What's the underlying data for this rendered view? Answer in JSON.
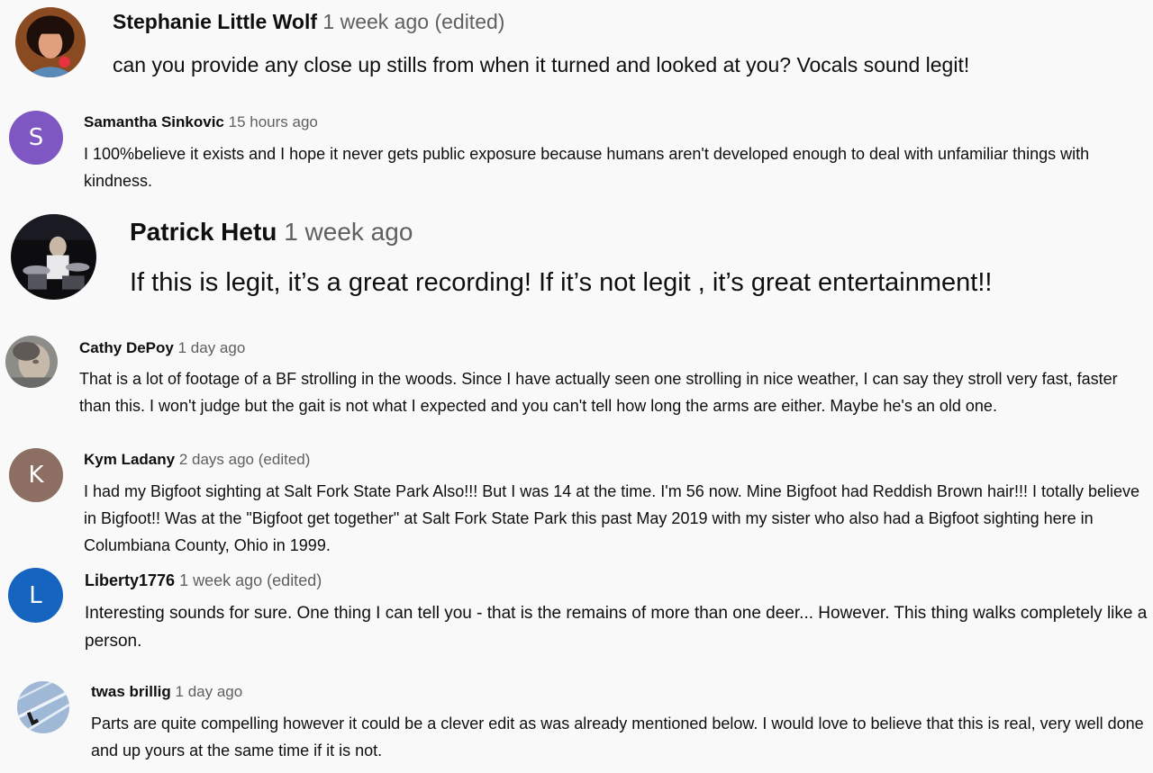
{
  "comments": [
    {
      "author": "Stephanie Little Wolf",
      "time": "1 week ago",
      "edited": "(edited)",
      "text": "can you provide any close up stills from when it turned and looked at you? Vocals sound legit!",
      "avatar": {
        "type": "photo",
        "icon": "woman-portrait-photo"
      }
    },
    {
      "author": "Samantha Sinkovic",
      "time": "15 hours ago",
      "edited": "",
      "text": "I 100%believe it exists and I hope it never gets public exposure because humans aren't developed enough to deal with unfamiliar things with kindness.",
      "avatar": {
        "type": "letter",
        "letter": "S",
        "color": "#7e57c2"
      }
    },
    {
      "author": "Patrick Hetu",
      "time": "1 week ago",
      "edited": "",
      "text": "If this is legit, it’s a great recording! If it’s not legit , it’s great entertainment!!",
      "avatar": {
        "type": "photo",
        "icon": "drummer-photo"
      }
    },
    {
      "author": "Cathy DePoy",
      "time": "1 day ago",
      "edited": "",
      "text": "That is a lot of footage of a BF strolling in the woods. Since I have actually seen one strolling in nice weather,  I can say they stroll very fast, faster than this. I won't judge but the gait is not what I expected and you can't tell how long the arms are either. Maybe he's an old one.",
      "avatar": {
        "type": "photo",
        "icon": "blurred-face-photo"
      }
    },
    {
      "author": "Kym Ladany",
      "time": "2 days ago",
      "edited": "(edited)",
      "text": "I had my Bigfoot sighting at Salt Fork State Park Also!!! But I was 14 at the time. I'm 56 now. Mine Bigfoot had Reddish Brown hair!!! I totally believe in Bigfoot!! Was at the \"Bigfoot get together\" at Salt Fork State Park this past May 2019 with my sister who also had a Bigfoot sighting here in Columbiana County, Ohio in 1999.",
      "avatar": {
        "type": "letter",
        "letter": "K",
        "color": "#8d6e63"
      }
    },
    {
      "author": "Liberty1776",
      "time": "1 week ago",
      "edited": "(edited)",
      "text": "Interesting sounds for sure.  One thing I can tell you  - that is the remains of more than one deer...   However.  This thing walks completely like a person.",
      "avatar": {
        "type": "letter",
        "letter": "L",
        "color": "#1565c0"
      }
    },
    {
      "author": "twas brillig",
      "time": "1 day ago",
      "edited": "",
      "text": "Parts are quite compelling however it could be a clever edit as was already mentioned below. I would love to believe that this is real, very well done and up yours at the same time if it is not.",
      "avatar": {
        "type": "photo",
        "icon": "sky-contrail-photo"
      }
    }
  ]
}
